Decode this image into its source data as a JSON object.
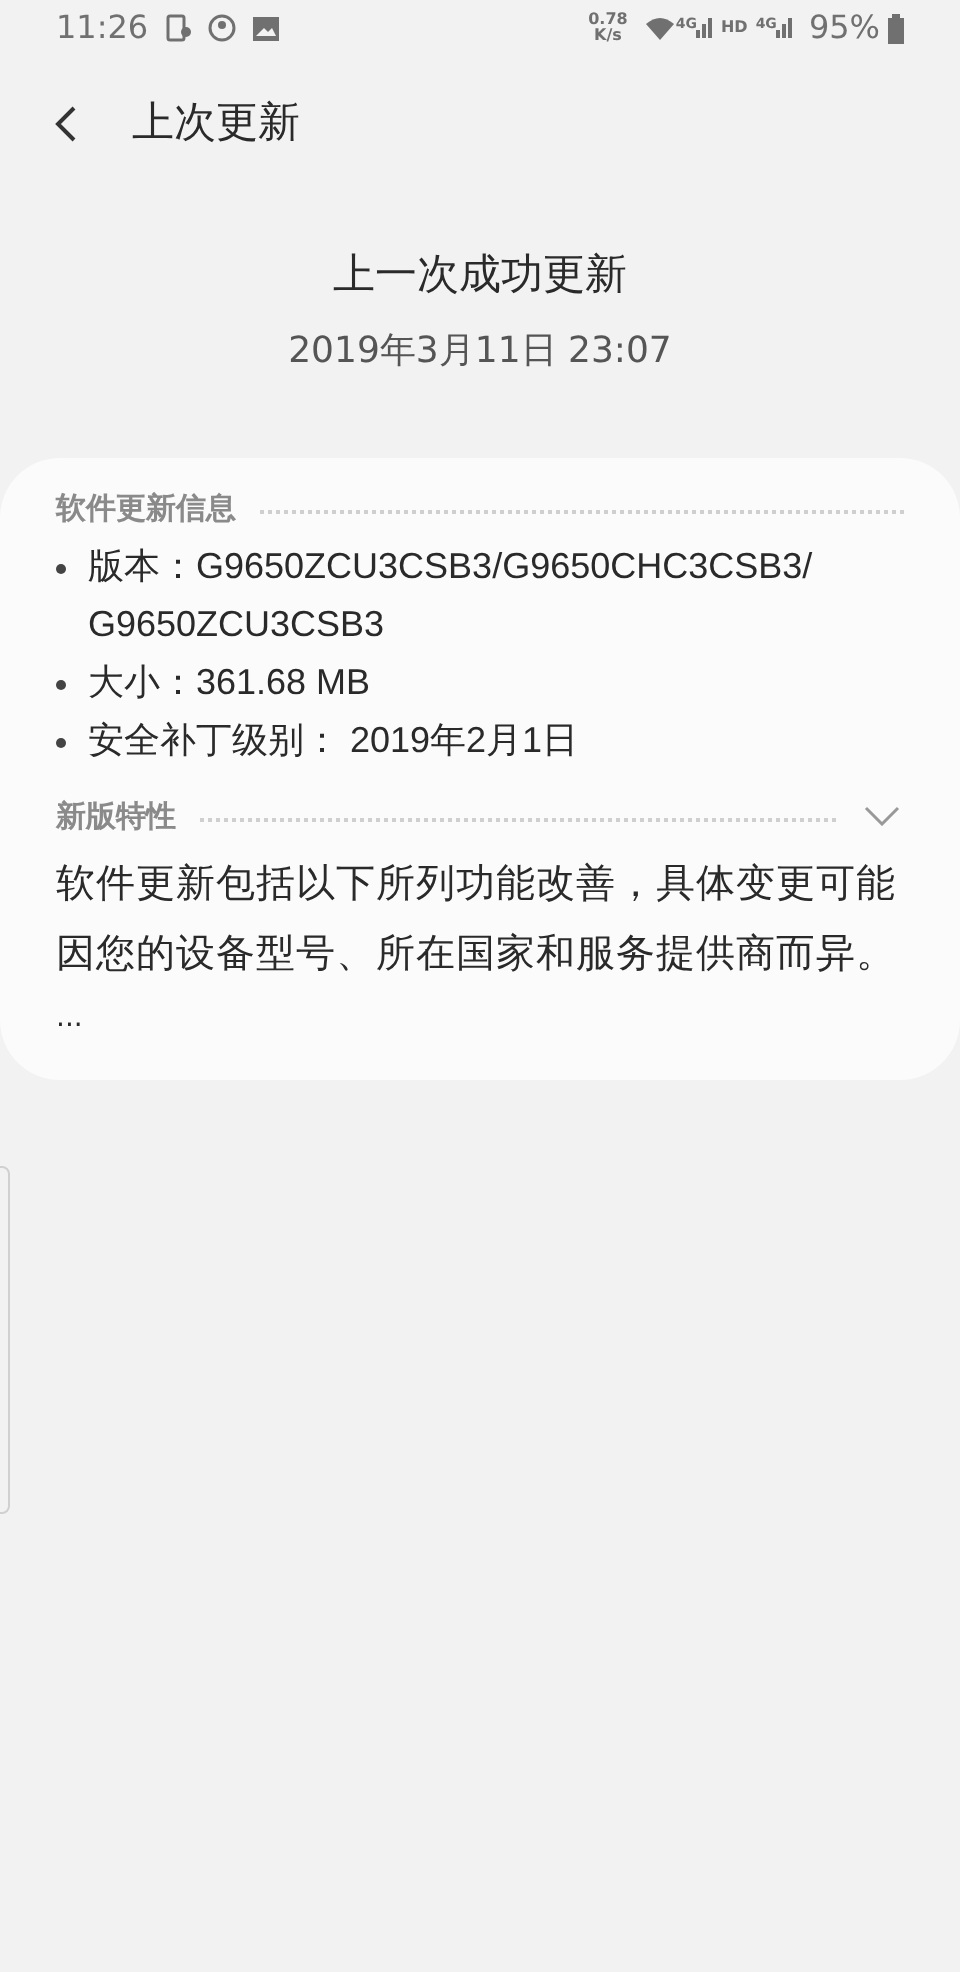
{
  "status_bar": {
    "time": "11:26",
    "speed_value": "0.78",
    "speed_unit": "K/s",
    "network_1": "4G",
    "hd": "HD",
    "network_2": "4G",
    "battery": "95%"
  },
  "header": {
    "title": "上次更新"
  },
  "summary": {
    "heading": "上一次成功更新",
    "date": "2019年3月11日 23:07"
  },
  "info": {
    "heading": "软件更新信息",
    "items": [
      "版本：G9650ZCU3CSB3/G9650CHC3CSB3/G9650ZCU3CSB3",
      "大小：361.68 MB",
      "安全补丁级别： 2019年2月1日"
    ]
  },
  "features": {
    "heading": "新版特性",
    "expanded": false,
    "text": "软件更新包括以下所列功能改善，具体变更可能因您的设备型号、所在国家和服务提供商而异。",
    "more": "..."
  }
}
